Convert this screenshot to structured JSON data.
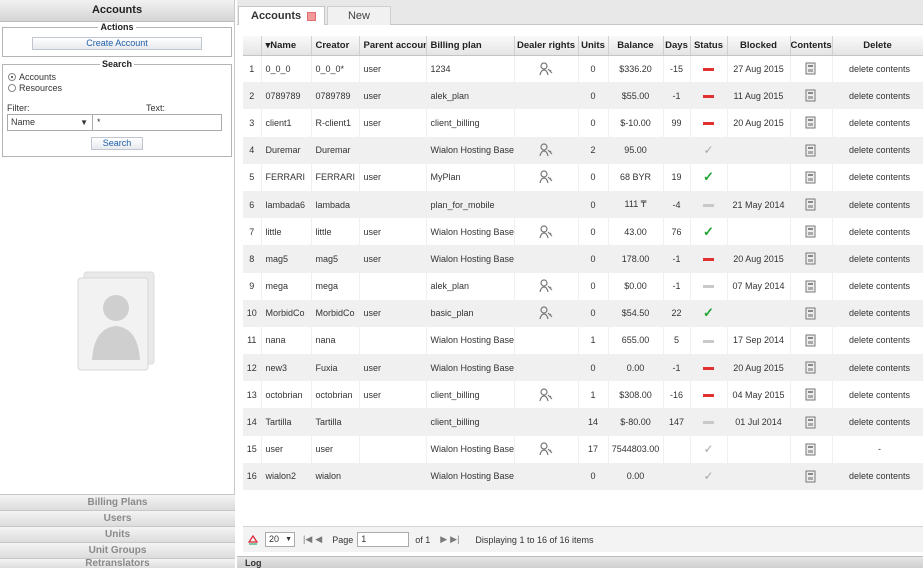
{
  "sidebar": {
    "header": "Accounts",
    "actions": {
      "legend": "Actions",
      "create_label": "Create Account"
    },
    "search": {
      "legend": "Search",
      "radio_accounts": "Accounts",
      "radio_resources": "Resources",
      "filter_label": "Filter:",
      "text_label": "Text:",
      "filter_value": "Name",
      "text_value": "*",
      "search_label": "Search"
    },
    "sections": [
      "Billing Plans",
      "Users",
      "Units",
      "Unit Groups",
      "Retranslators"
    ]
  },
  "tabs": {
    "accounts": "Accounts",
    "new": "New"
  },
  "table": {
    "headers": {
      "name": "Name",
      "creator": "Creator",
      "parent": "Parent account",
      "plan": "Billing plan",
      "dealer": "Dealer rights",
      "units": "Units",
      "balance": "Balance",
      "days": "Days",
      "status": "Status",
      "blocked": "Blocked",
      "contents": "Contents",
      "delete": "Delete"
    },
    "sort_indicator": "▾",
    "rows": [
      {
        "n": "1",
        "name": "0_0_0",
        "creator": "0_0_0*",
        "parent": "user",
        "plan": "1234",
        "dealer": true,
        "units": "0",
        "balance": "$336.20",
        "days": "-15",
        "days_dim": false,
        "status": "red",
        "blocked": "27 Aug 2015",
        "delete": "delete contents"
      },
      {
        "n": "2",
        "name": "0789789",
        "creator": "0789789",
        "parent": "user",
        "plan": "alek_plan",
        "dealer": false,
        "units": "0",
        "balance": "$55.00",
        "days": "-1",
        "days_dim": true,
        "status": "red",
        "blocked": "11 Aug 2015",
        "delete": "delete contents"
      },
      {
        "n": "3",
        "name": "client1",
        "creator": "R-client1",
        "parent": "user",
        "plan": "client_billing",
        "dealer": false,
        "units": "0",
        "balance": "$-10.00",
        "days": "99",
        "days_dim": false,
        "status": "red",
        "blocked": "20 Aug 2015",
        "delete": "delete contents"
      },
      {
        "n": "4",
        "name": "Duremar",
        "creator": "Duremar",
        "parent": "",
        "plan": "Wialon Hosting Base",
        "dealer": true,
        "units": "2",
        "balance": "95.00",
        "days": "",
        "days_dim": false,
        "status": "check-grey",
        "blocked": "",
        "delete": "delete contents"
      },
      {
        "n": "5",
        "name": "FERRARI",
        "creator": "FERRARI",
        "parent": "user",
        "plan": "MyPlan",
        "dealer": true,
        "units": "0",
        "balance": "68 BYR",
        "days": "19",
        "days_dim": false,
        "status": "check",
        "blocked": "",
        "delete": "delete contents"
      },
      {
        "n": "6",
        "name": "lambada6",
        "creator": "lambada",
        "parent": "",
        "plan": "plan_for_mobile",
        "dealer": false,
        "units": "0",
        "balance": "111 ₸",
        "days": "-4",
        "days_dim": true,
        "status": "grey",
        "blocked": "21 May 2014",
        "delete": "delete contents"
      },
      {
        "n": "7",
        "name": "little",
        "creator": "little",
        "parent": "user",
        "plan": "Wialon Hosting Base",
        "dealer": true,
        "units": "0",
        "balance": "43.00",
        "days": "76",
        "days_dim": false,
        "status": "check",
        "blocked": "",
        "delete": "delete contents"
      },
      {
        "n": "8",
        "name": "mag5",
        "creator": "mag5",
        "parent": "user",
        "plan": "Wialon Hosting Base",
        "dealer": false,
        "units": "0",
        "balance": "178.00",
        "days": "-1",
        "days_dim": false,
        "status": "red",
        "blocked": "20 Aug 2015",
        "delete": "delete contents"
      },
      {
        "n": "9",
        "name": "mega",
        "creator": "mega",
        "parent": "",
        "plan": "alek_plan",
        "dealer": true,
        "units": "0",
        "balance": "$0.00",
        "days": "-1",
        "days_dim": true,
        "status": "grey",
        "blocked": "07 May 2014",
        "delete": "delete contents"
      },
      {
        "n": "10",
        "name": "MorbidCo",
        "creator": "MorbidCo",
        "parent": "user",
        "plan": "basic_plan",
        "dealer": true,
        "units": "0",
        "balance": "$54.50",
        "days": "22",
        "days_dim": false,
        "status": "check",
        "blocked": "",
        "delete": "delete contents"
      },
      {
        "n": "11",
        "name": "nana",
        "creator": "nana",
        "parent": "",
        "plan": "Wialon Hosting Base",
        "dealer": false,
        "units": "1",
        "balance": "655.00",
        "days": "5",
        "days_dim": false,
        "status": "grey",
        "blocked": "17 Sep 2014",
        "delete": "delete contents"
      },
      {
        "n": "12",
        "name": "new3",
        "creator": "Fuxia",
        "parent": "user",
        "plan": "Wialon Hosting Base",
        "dealer": false,
        "units": "0",
        "balance": "0.00",
        "days": "-1",
        "days_dim": false,
        "status": "red",
        "blocked": "20 Aug 2015",
        "delete": "delete contents"
      },
      {
        "n": "13",
        "name": "octobrian",
        "creator": "octobrian",
        "parent": "user",
        "plan": "client_billing",
        "dealer": true,
        "units": "1",
        "balance": "$308.00",
        "days": "-16",
        "days_dim": false,
        "status": "red",
        "blocked": "04 May 2015",
        "delete": "delete contents"
      },
      {
        "n": "14",
        "name": "Tartilla",
        "creator": "Tartilla",
        "parent": "",
        "plan": "client_billing",
        "dealer": false,
        "units": "14",
        "balance": "$-80.00",
        "days": "147",
        "days_dim": true,
        "status": "grey",
        "blocked": "01 Jul 2014",
        "delete": "delete contents"
      },
      {
        "n": "15",
        "name": "user",
        "creator": "user",
        "parent": "",
        "plan": "Wialon Hosting Base",
        "dealer": true,
        "units": "17",
        "balance": "7544803.00",
        "days": "",
        "days_dim": false,
        "status": "check-grey",
        "blocked": "",
        "delete": "-"
      },
      {
        "n": "16",
        "name": "wialon2",
        "creator": "wialon",
        "parent": "",
        "plan": "Wialon Hosting Base",
        "dealer": false,
        "units": "0",
        "balance": "0.00",
        "days": "",
        "days_dim": false,
        "status": "check-grey",
        "blocked": "",
        "delete": "delete contents"
      }
    ]
  },
  "pager": {
    "page_size": "20",
    "page_label": "Page",
    "page_value": "1",
    "of_label": "of 1",
    "display_text": "Displaying 1 to 16 of 16 items"
  },
  "log_label": "Log",
  "colors": {
    "delete_link": "#e0262a",
    "status_ok": "#21a336",
    "status_blocked": "#e03030"
  }
}
